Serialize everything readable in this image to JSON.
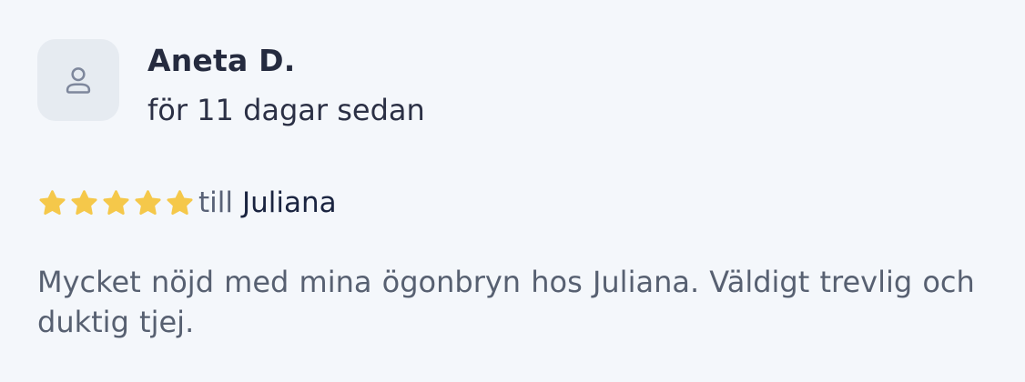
{
  "review": {
    "reviewer_name": "Aneta D.",
    "date": "för 11 dagar sedan",
    "avatar_icon": "user-icon",
    "rating": 5,
    "rating_max": 5,
    "rating_prefix": "till",
    "stylist_name": "Juliana",
    "text": "Mycket nöjd med mina ögonbryn hos Juliana. Väldigt trevlig och duktig tjej.",
    "star_color": "#f5c84a",
    "star_icon": "star-icon"
  }
}
